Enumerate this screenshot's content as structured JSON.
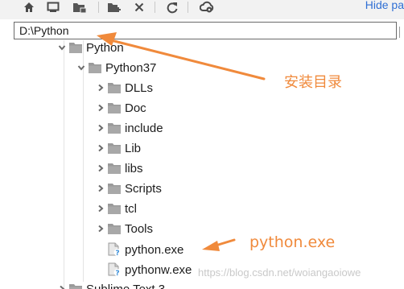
{
  "toolbar": {
    "icons": [
      "home-icon",
      "monitor-icon",
      "project-folder-icon",
      "new-folder-icon",
      "delete-icon",
      "refresh-icon",
      "cloud-icon"
    ],
    "hide_path_label": "Hide pa"
  },
  "path_field": {
    "value": "D:\\Python"
  },
  "tree": {
    "rows": [
      {
        "label": "Python",
        "type": "folder",
        "state": "expanded"
      },
      {
        "label": "Python37",
        "type": "folder",
        "state": "expanded"
      },
      {
        "label": "DLLs",
        "type": "folder",
        "state": "collapsed"
      },
      {
        "label": "Doc",
        "type": "folder",
        "state": "collapsed"
      },
      {
        "label": "include",
        "type": "folder",
        "state": "collapsed"
      },
      {
        "label": "Lib",
        "type": "folder",
        "state": "collapsed"
      },
      {
        "label": "libs",
        "type": "folder",
        "state": "collapsed"
      },
      {
        "label": "Scripts",
        "type": "folder",
        "state": "collapsed"
      },
      {
        "label": "tcl",
        "type": "folder",
        "state": "collapsed"
      },
      {
        "label": "Tools",
        "type": "folder",
        "state": "collapsed"
      },
      {
        "label": "python.exe",
        "type": "unknown-file"
      },
      {
        "label": "pythonw.exe",
        "type": "unknown-file"
      },
      {
        "label": "Sublime Text 3",
        "type": "folder",
        "state": "collapsed"
      }
    ]
  },
  "annotations": {
    "install_dir_label": "安装目录",
    "python_exe_label": "python.exe",
    "accent_color": "#f08a3c"
  },
  "watermark": "https://blog.csdn.net/woiangaoiowe"
}
